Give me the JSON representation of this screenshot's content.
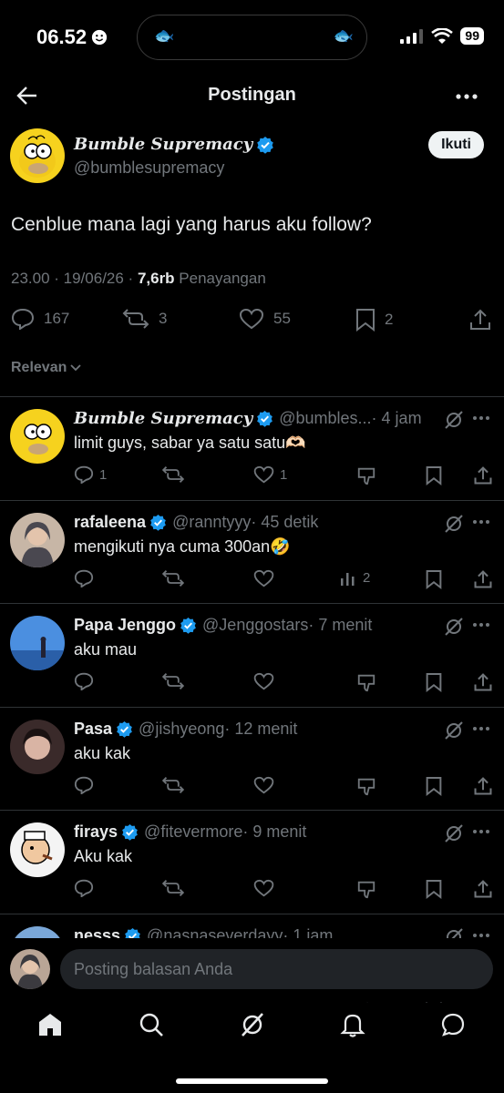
{
  "status_bar": {
    "time": "06.52",
    "battery": "99"
  },
  "header": {
    "title": "Postingan"
  },
  "post": {
    "author_name": "Bumble Supremacy",
    "author_handle": "@bumblesupremacy",
    "follow_label": "Ikuti",
    "text": "Cenblue mana lagi yang harus aku follow?",
    "timestamp": "23.00 · 19/06/26 · ",
    "views_count": "7,6rb",
    "views_label": " Penayangan",
    "stats": {
      "replies": "167",
      "reposts": "3",
      "likes": "55",
      "bookmarks": "2"
    }
  },
  "sort": {
    "label": "Relevan"
  },
  "replies": [
    {
      "name": "Bumble Supremacy",
      "handle": "@bumbles...",
      "time": " · 4 jam",
      "text": "limit guys, sabar ya satu satu🫶🏻",
      "replies": "1",
      "likes": "1",
      "views": ""
    },
    {
      "name": "rafaleena",
      "handle": "@ranntyyy",
      "time": " · 45 detik",
      "text": "mengikuti nya cuma 300an🤣",
      "replies": "",
      "likes": "",
      "views": "2"
    },
    {
      "name": "Papa Jenggo",
      "handle": "@Jenggostars",
      "time": " · 7 menit",
      "text": "aku mau",
      "replies": "",
      "likes": "",
      "views": ""
    },
    {
      "name": "Pasa",
      "handle": "@jishyeong",
      "time": " · 12 menit",
      "text": "aku kak",
      "replies": "",
      "likes": "",
      "views": ""
    },
    {
      "name": "firays",
      "handle": "@fitevermore",
      "time": " · 9 menit",
      "text": "Aku kak",
      "replies": "",
      "likes": "",
      "views": ""
    },
    {
      "name": "nesss",
      "handle": "@nasnaseverdayy",
      "time": " · 1 jam",
      "text": "",
      "replies": "",
      "likes": "",
      "views": ""
    }
  ],
  "composer": {
    "placeholder": "Posting balasan Anda"
  },
  "nav": [
    "home-icon",
    "search-icon",
    "grok-icon",
    "notifications-icon",
    "messages-icon"
  ],
  "colors": {
    "background": "#000000",
    "verified": "#1d9bf0",
    "muted": "#71767b",
    "text": "#e7e9ea"
  }
}
